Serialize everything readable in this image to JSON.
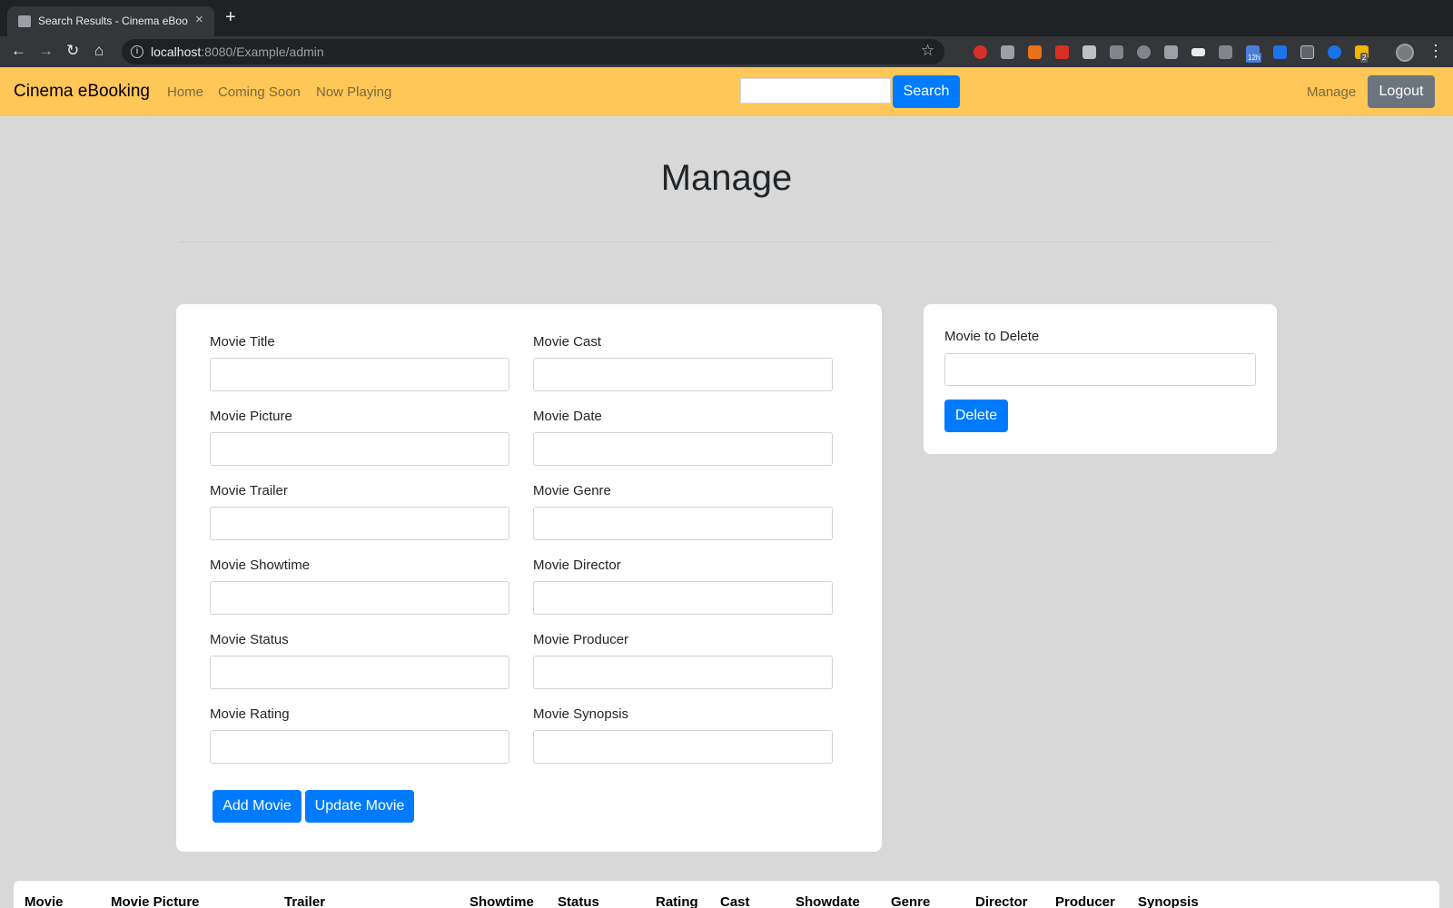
{
  "browser": {
    "tab_title": "Search Results - Cinema eBook",
    "tab_close": "×",
    "new_tab": "+",
    "url_host": "localhost",
    "url_rest": ":8080/Example/admin"
  },
  "navbar": {
    "brand": "Cinema eBooking",
    "links": [
      "Home",
      "Coming Soon",
      "Now Playing"
    ],
    "search_placeholder": "",
    "search_button": "Search",
    "manage": "Manage",
    "logout": "Logout"
  },
  "page": {
    "title": "Manage"
  },
  "form": {
    "left_fields": [
      "Movie Title",
      "Movie Picture",
      "Movie Trailer",
      "Movie Showtime",
      "Movie Status",
      "Movie Rating"
    ],
    "right_fields": [
      "Movie Cast",
      "Movie Date",
      "Movie Genre",
      "Movie Director",
      "Movie Producer",
      "Movie Synopsis"
    ],
    "add_button": "Add Movie",
    "update_button": "Update Movie"
  },
  "delete_form": {
    "label": "Movie to Delete",
    "button": "Delete"
  },
  "table": {
    "headers": [
      "Movie",
      "Movie Picture",
      "Trailer",
      "Showtime",
      "Status",
      "Rating",
      "Cast",
      "Showdate",
      "Genre",
      "Director",
      "Producer",
      "Synopsis"
    ]
  },
  "colors": {
    "navbar": "#ffc658",
    "primary": "#007bff",
    "secondary": "#6c757d",
    "background": "#d8d8d8"
  }
}
